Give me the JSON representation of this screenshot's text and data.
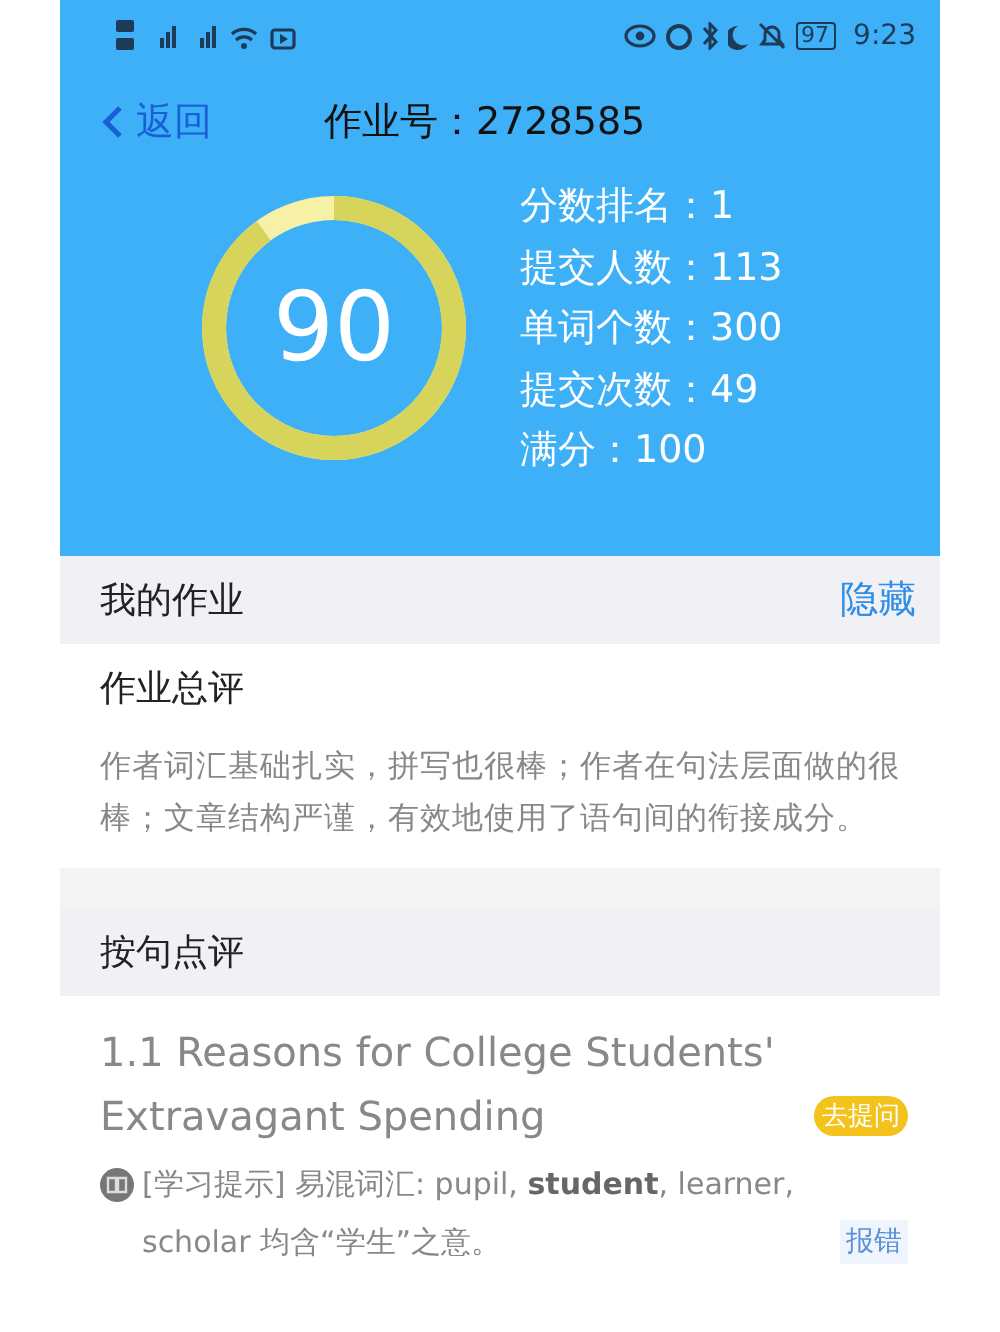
{
  "status_bar": {
    "battery": "97",
    "time": "9:23"
  },
  "header": {
    "back": "返回",
    "title": "作业号：2728585"
  },
  "score": {
    "value": "90"
  },
  "stats": [
    "分数排名：1",
    "提交人数：113",
    "单词个数：300",
    "提交次数：49",
    "满分：100"
  ],
  "my_homework": {
    "title": "我的作业",
    "action": "隐藏"
  },
  "overall": {
    "title": "作业总评",
    "comment": "作者词汇基础扎实，拼写也很棒；作者在句法层面做的很棒；文章结构严谨，有效地使用了语句间的衔接成分。"
  },
  "sentence_review": {
    "title": "按句点评",
    "items": [
      {
        "sentence": "1.1 Reasons for College Students' Extravagant Spending",
        "ask": "去提问",
        "hint": "[学习提示] 易混词汇: pupil, **student**, learner, scholar 均含“学生”之意。",
        "report": "报错"
      }
    ]
  }
}
